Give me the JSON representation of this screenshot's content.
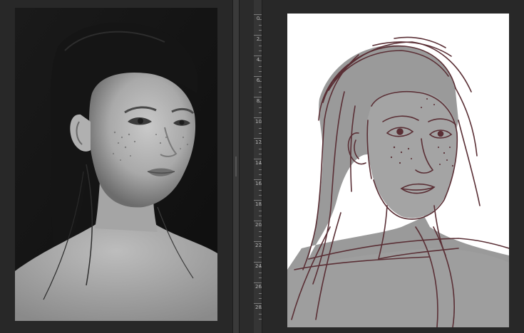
{
  "window": {
    "layout": "two-up document view",
    "background_color": "#282828",
    "panel_color": "#3a3a3a"
  },
  "left_document": {
    "content": "reference-photo",
    "icon": "photo-icon",
    "tone": "grayscale"
  },
  "right_document": {
    "content": "sketch-canvas",
    "icon": "sketch-icon",
    "canvas_color": "#ffffff",
    "stroke_color": "#5a2f35",
    "fill_color": "#9a9a9a"
  },
  "vertical_ruler": {
    "labels": [
      "0",
      "2",
      "4",
      "6",
      "8",
      "10",
      "12",
      "14",
      "16",
      "18",
      "20",
      "22",
      "24",
      "26",
      "28"
    ]
  }
}
